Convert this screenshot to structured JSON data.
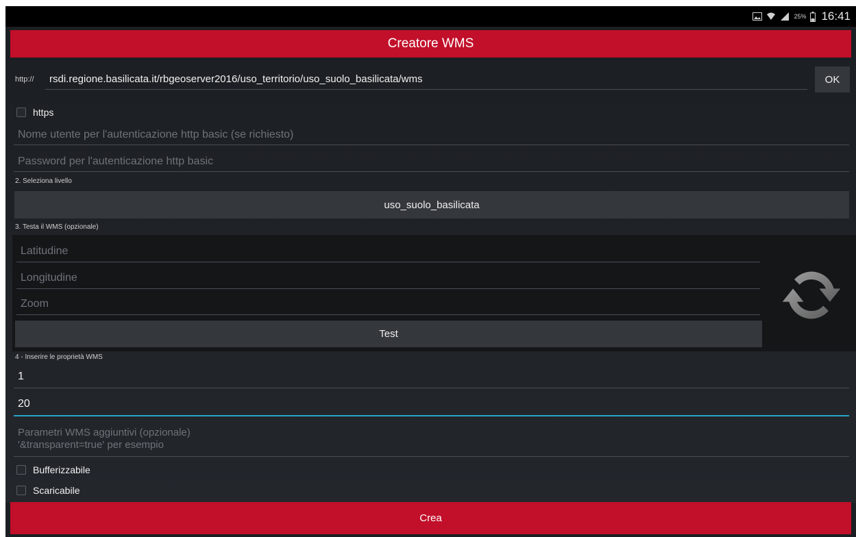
{
  "status_bar": {
    "battery_percent": "25%",
    "time": "16:41",
    "icons": [
      "image-notification-icon",
      "wifi-icon",
      "signal-icon",
      "battery-icon"
    ]
  },
  "header": {
    "title": "Creatore WMS"
  },
  "url_section": {
    "prefix": "http://",
    "url_value": "rsdi.regione.basilicata.it/rbgeoserver2016/uso_territorio/uso_suolo_basilicata/wms",
    "ok_label": "OK",
    "https_label": "https"
  },
  "auth": {
    "username_placeholder": "Nome utente per l'autenticazione http basic (se richiesto)",
    "password_placeholder": "Password per l'autenticazione http basic"
  },
  "layer_section": {
    "label": "2. Seleziona livello",
    "selected_layer": "uso_suolo_basilicata"
  },
  "test_section": {
    "label": "3. Testa il WMS (opzionale)",
    "latitude_placeholder": "Latitudine",
    "longitude_placeholder": "Longitudine",
    "zoom_placeholder": "Zoom",
    "test_label": "Test"
  },
  "properties_section": {
    "label": "4 - Inserire le proprietà WMS",
    "field1_value": "1",
    "field2_value": "20",
    "extra_params_placeholder": "Parametri WMS aggiuntivi (opzionale)\n'&transparent=true' per esempio",
    "bufferizzabile_label": "Bufferizzabile",
    "scaricabile_label": "Scaricabile"
  },
  "footer": {
    "create_label": "Crea"
  },
  "colors": {
    "accent_red": "#c20f2a",
    "focus_blue": "#2aa3c9",
    "background": "#1b1e22"
  }
}
